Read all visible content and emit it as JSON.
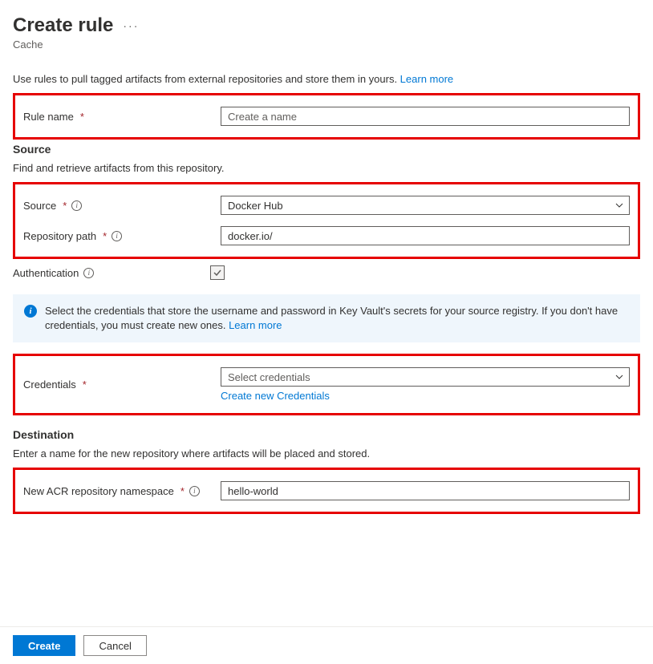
{
  "header": {
    "title": "Create rule",
    "subtitle": "Cache"
  },
  "intro": {
    "text": "Use rules to pull tagged artifacts from external repositories and store them in yours. ",
    "learn_more": "Learn more"
  },
  "ruleName": {
    "label": "Rule name",
    "placeholder": "Create a name",
    "value": ""
  },
  "sourceSection": {
    "heading": "Source",
    "subheading": "Find and retrieve artifacts from this repository.",
    "source": {
      "label": "Source",
      "value": "Docker Hub"
    },
    "repoPath": {
      "label": "Repository path",
      "value": "docker.io/"
    },
    "auth": {
      "label": "Authentication",
      "checked": true
    }
  },
  "infoBanner": {
    "text": "Select the credentials that store the username and password in Key Vault's secrets for your source registry. If you don't have credentials, you must create new ones. ",
    "learn_more": "Learn more"
  },
  "credentials": {
    "label": "Credentials",
    "placeholder": "Select credentials",
    "create_new": "Create new Credentials"
  },
  "destSection": {
    "heading": "Destination",
    "subheading": "Enter a name for the new repository where artifacts will be placed and stored.",
    "namespace": {
      "label": "New ACR repository namespace",
      "value": "hello-world"
    }
  },
  "footer": {
    "create": "Create",
    "cancel": "Cancel"
  }
}
